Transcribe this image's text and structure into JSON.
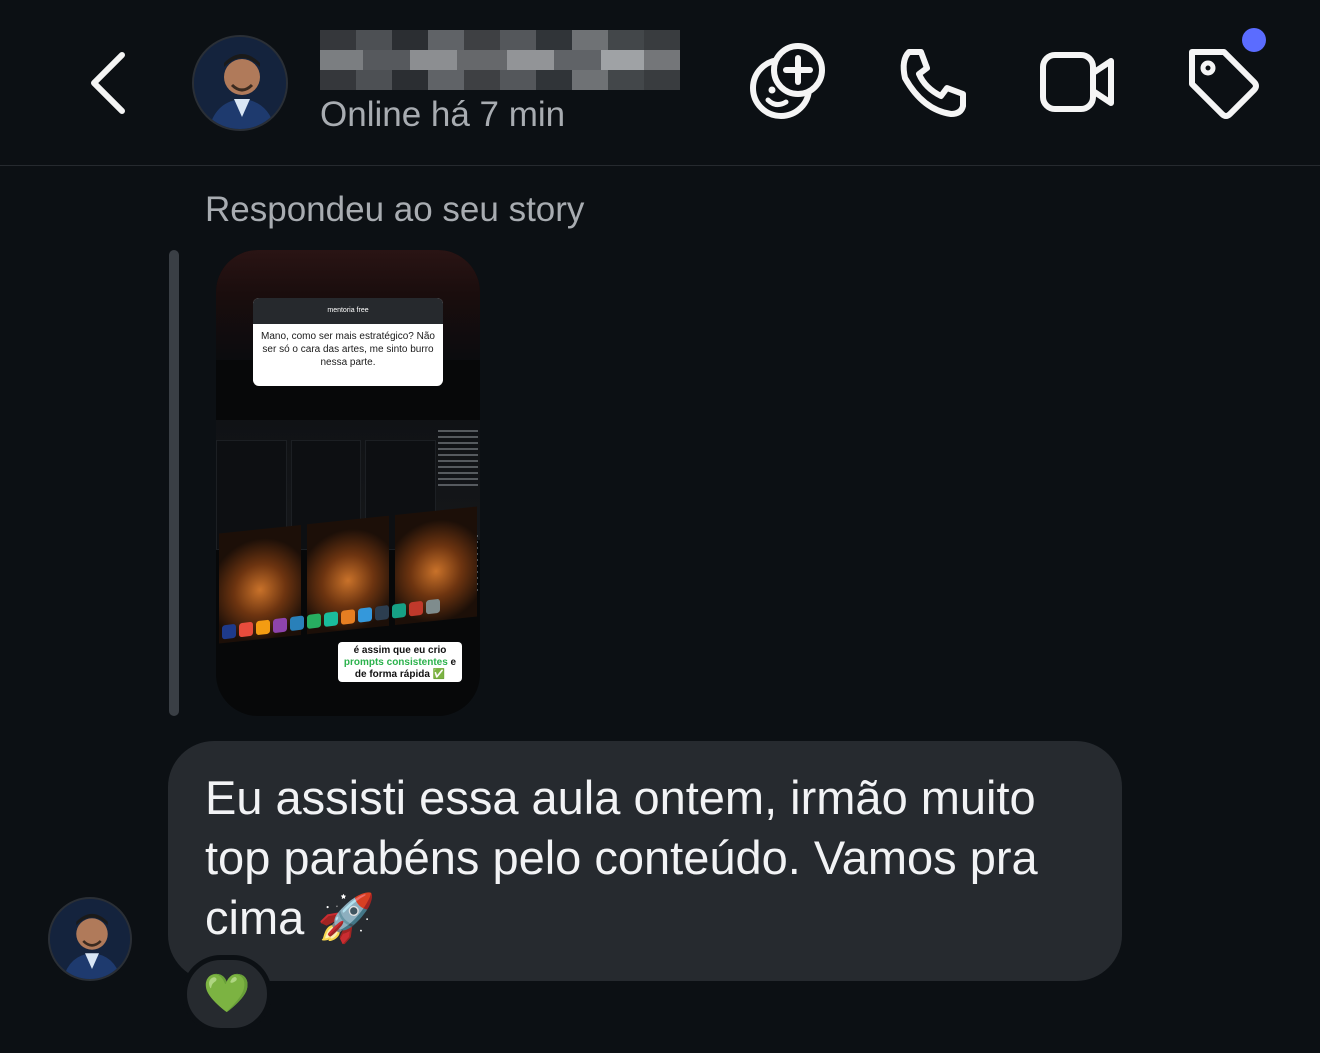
{
  "header": {
    "contact_name": "",
    "status": "Online há 7 min",
    "icons": [
      "back-icon",
      "avatar",
      "sticker-add-icon",
      "phone-icon",
      "video-icon",
      "tag-icon"
    ],
    "notification_dot_color": "#5b6cff"
  },
  "thread": {
    "replied_label": "Respondeu ao seu story",
    "story": {
      "question_title": "mentoria free",
      "question_text": "Mano, como ser mais estratégico? Não ser só o cara das artes, me sinto burro nessa parte.",
      "caption_line1": "é assim que eu crio",
      "caption_green": "prompts consistentes",
      "caption_e": " e",
      "caption_line3": "de forma rápida ✅"
    },
    "message": {
      "text": "Eu assisti essa aula ontem, irmão muito top parabéns pelo conteúdo. Vamos pra cima 🚀",
      "reaction": "💚"
    }
  },
  "colors": {
    "background": "#0c1014",
    "bubble": "#262a2f",
    "muted_text": "#a8acb1",
    "reply_bar": "#3a3f45"
  }
}
